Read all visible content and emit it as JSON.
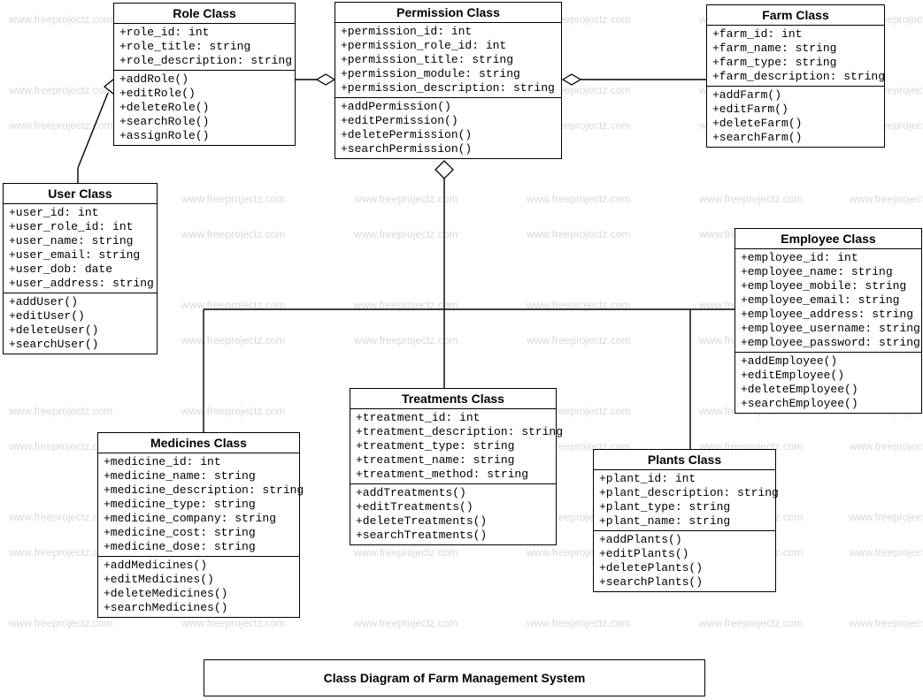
{
  "watermark": "www.freeprojectz.com",
  "caption": "Class Diagram of Farm Management System",
  "classes": {
    "role": {
      "title": "Role Class",
      "attrs": [
        "+role_id: int",
        "+role_title: string",
        "+role_description: string"
      ],
      "ops": [
        "+addRole()",
        "+editRole()",
        "+deleteRole()",
        "+searchRole()",
        "+assignRole()"
      ]
    },
    "permission": {
      "title": "Permission Class",
      "attrs": [
        "+permission_id: int",
        "+permission_role_id: int",
        "+permission_title: string",
        "+permission_module: string",
        "+permission_description: string"
      ],
      "ops": [
        "+addPermission()",
        "+editPermission()",
        "+deletePermission()",
        "+searchPermission()"
      ]
    },
    "farm": {
      "title": "Farm Class",
      "attrs": [
        "+farm_id: int",
        "+farm_name: string",
        "+farm_type: string",
        "+farm_description: string"
      ],
      "ops": [
        "+addFarm()",
        "+editFarm()",
        "+deleteFarm()",
        "+searchFarm()"
      ]
    },
    "user": {
      "title": "User Class",
      "attrs": [
        "+user_id: int",
        "+user_role_id: int",
        "+user_name: string",
        "+user_email: string",
        "+user_dob: date",
        "+user_address: string"
      ],
      "ops": [
        "+addUser()",
        "+editUser()",
        "+deleteUser()",
        "+searchUser()"
      ]
    },
    "employee": {
      "title": "Employee Class",
      "attrs": [
        "+employee_id: int",
        "+employee_name: string",
        "+employee_mobile: string",
        "+employee_email: string",
        "+employee_address: string",
        "+employee_username: string",
        "+employee_password: string"
      ],
      "ops": [
        "+addEmployee()",
        "+editEmployee()",
        "+deleteEmployee()",
        "+searchEmployee()"
      ]
    },
    "treatments": {
      "title": "Treatments Class",
      "attrs": [
        "+treatment_id: int",
        "+treatment_description: string",
        "+treatment_type: string",
        "+treatment_name: string",
        "+treatment_method: string"
      ],
      "ops": [
        "+addTreatments()",
        "+editTreatments()",
        "+deleteTreatments()",
        "+searchTreatments()"
      ]
    },
    "medicines": {
      "title": "Medicines Class",
      "attrs": [
        "+medicine_id: int",
        "+medicine_name: string",
        "+medicine_description: string",
        "+medicine_type: string",
        "+medicine_company: string",
        "+medicine_cost: string",
        "+medicine_dose: string"
      ],
      "ops": [
        "+addMedicines()",
        "+editMedicines()",
        "+deleteMedicines()",
        "+searchMedicines()"
      ]
    },
    "plants": {
      "title": "Plants Class",
      "attrs": [
        "+plant_id: int",
        "+plant_description: string",
        "+plant_type: string",
        "+plant_name: string"
      ],
      "ops": [
        "+addPlants()",
        "+editPlants()",
        "+deletePlants()",
        "+searchPlants()"
      ]
    }
  }
}
